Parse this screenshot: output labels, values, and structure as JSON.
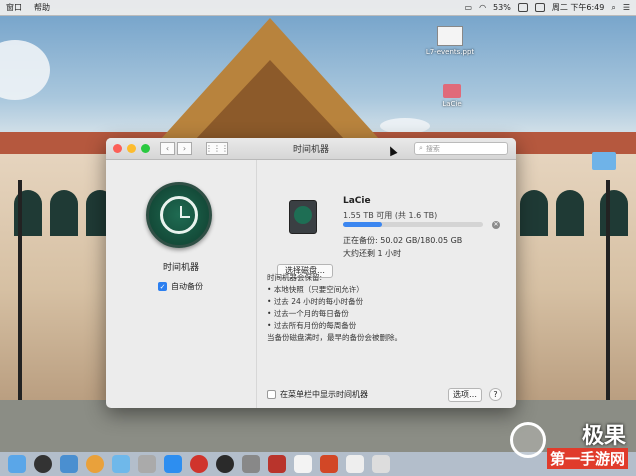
{
  "menubar": {
    "menus": [
      "窗口",
      "帮助"
    ],
    "battery": "53%",
    "clock": "周二 下午6:49"
  },
  "desktop": {
    "file1": "L7-events.ppt",
    "drive": "LaCie"
  },
  "window": {
    "title": "时间机器",
    "search_placeholder": "搜索",
    "app_label": "时间机器",
    "auto_backup_label": "自动备份",
    "auto_backup_checked": true,
    "disk": {
      "name": "LaCie",
      "available": "1.55 TB 可用 (共 1.6 TB)",
      "progress_fraction": 0.28,
      "status": "正在备份: 50.02 GB/180.05 GB",
      "remaining": "大约还剩 1 小时"
    },
    "select_disk_button": "选择磁盘…",
    "info_heading": "时间机器会保留:",
    "info_items": [
      "本地快照（只要空间允许）",
      "过去 24 小时的每小时备份",
      "过去一个月的每日备份",
      "过去所有月份的每周备份"
    ],
    "info_footer": "当备份磁盘满时，最早的备份会被删除。",
    "menu_checkbox_label": "在菜单栏中显示时间机器",
    "options_button": "选项…",
    "help_button": "?"
  },
  "watermark": {
    "top": "极果",
    "bottom": "第一手游网"
  }
}
